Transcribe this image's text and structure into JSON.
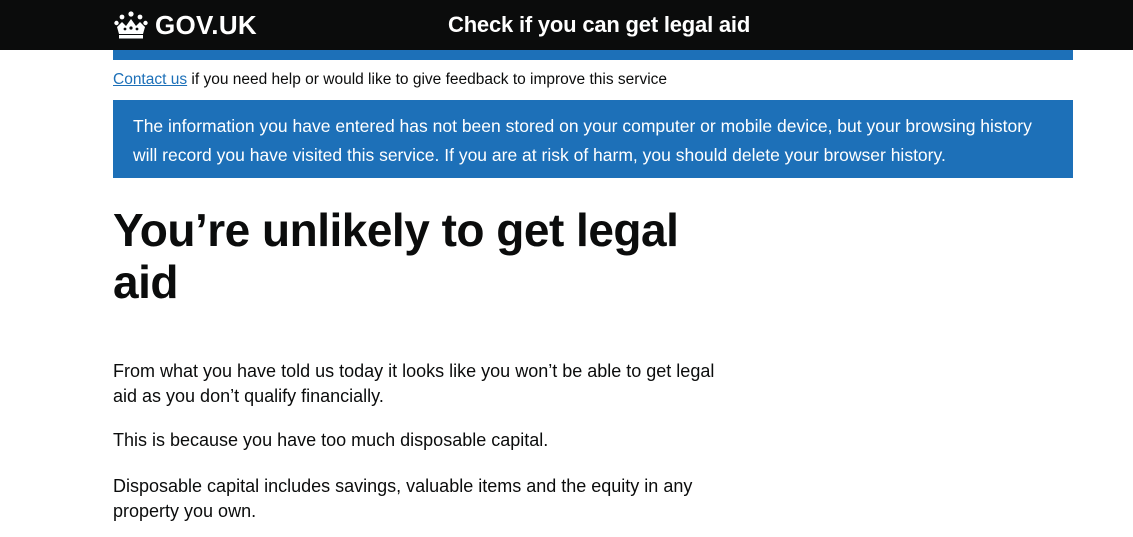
{
  "header": {
    "logo_text": "GOV.UK",
    "service_name": "Check if you can get legal aid"
  },
  "feedback": {
    "link_text": "Contact us",
    "text": " if you need help or would like to give feedback to improve this service"
  },
  "notice": {
    "text": "The information you have entered has not been stored on your computer or mobile device, but your browsing history will record you have visited this service. If you are at risk of harm, you should delete your browser history."
  },
  "main": {
    "title": "You’re unlikely to get legal aid",
    "paragraphs": [
      "From what you have told us today it looks like you won’t be able to get legal aid as you don’t qualify financially.",
      "This is because you have too much disposable capital.",
      "Disposable capital includes savings, valuable items and the equity in any property you own."
    ]
  },
  "colors": {
    "header_bg": "#0b0c0c",
    "brand_blue": "#1d70b8",
    "link": "#1d70b8",
    "text": "#0b0c0c"
  }
}
